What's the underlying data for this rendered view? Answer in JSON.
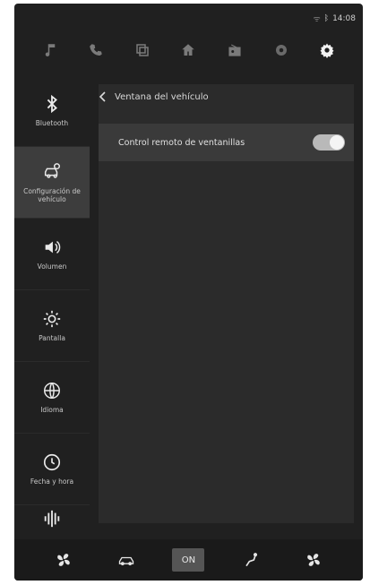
{
  "status_bar": {
    "signal": "ᯤ",
    "bluetooth": "ᛒ",
    "time": "14:08"
  },
  "top_nav": [
    {
      "icon": "music-icon"
    },
    {
      "icon": "phone-icon"
    },
    {
      "icon": "apps-icon"
    },
    {
      "icon": "home-icon"
    },
    {
      "icon": "radio-icon"
    },
    {
      "icon": "navigation-icon"
    },
    {
      "icon": "settings-icon",
      "active": true
    }
  ],
  "sidebar": {
    "items": [
      {
        "label": "Bluetooth",
        "icon": "bluetooth-icon"
      },
      {
        "label": "Configuración de vehículo",
        "icon": "car-settings-icon",
        "active": true
      },
      {
        "label": "Volumen",
        "icon": "volume-icon"
      },
      {
        "label": "Pantalla",
        "icon": "brightness-icon"
      },
      {
        "label": "Idioma",
        "icon": "globe-icon"
      },
      {
        "label": "Fecha y hora",
        "icon": "clock-icon"
      },
      {
        "label": "",
        "icon": "sound-wave-icon"
      }
    ]
  },
  "content": {
    "breadcrumb": "Ventana del vehículo",
    "rows": [
      {
        "label": "Control remoto de ventanillas",
        "toggle_on": true
      }
    ]
  },
  "bottom_bar": {
    "on_label": "ON"
  },
  "colors": {
    "background": "#202020",
    "active_item": "#3d3d3d",
    "panel": "#2b2b2b",
    "row": "#3a3a3a"
  }
}
